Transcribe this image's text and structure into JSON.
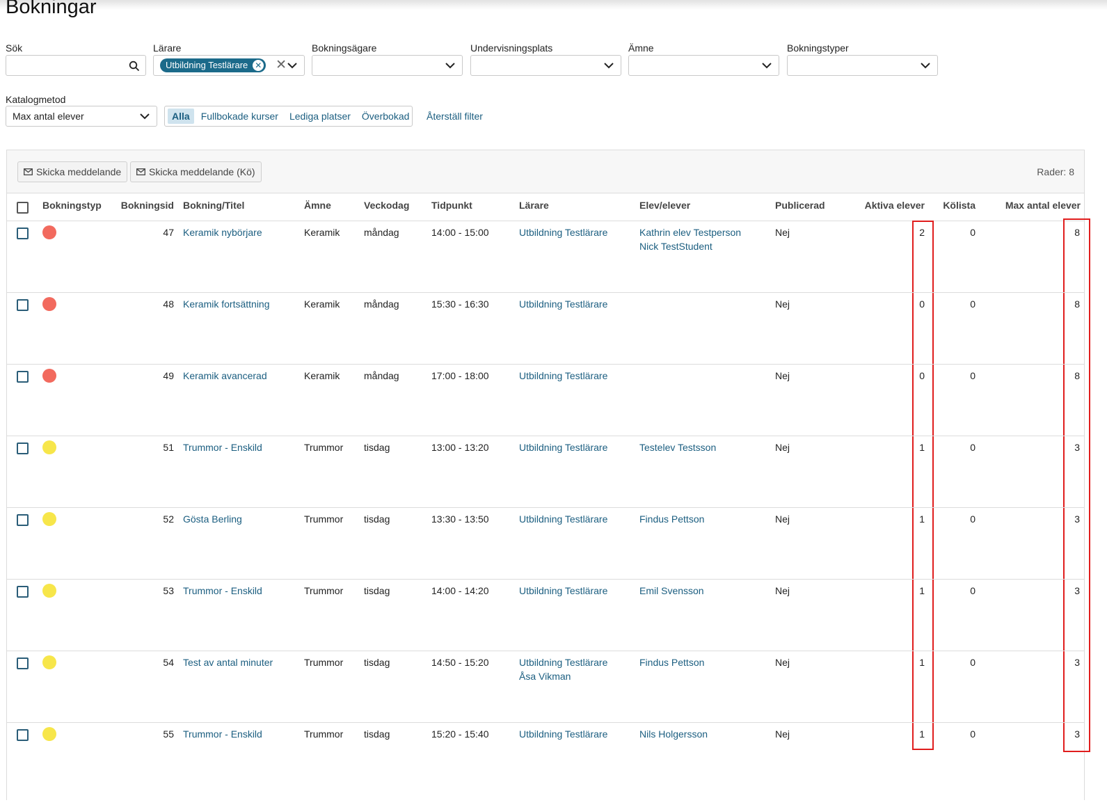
{
  "page": {
    "title": "Bokningar"
  },
  "filters": {
    "search": {
      "label": "Sök",
      "value": "",
      "icon": "search-icon"
    },
    "teacher": {
      "label": "Lärare",
      "chip": "Utbildning Testlärare",
      "chip_remove": "✕",
      "clear": "✕"
    },
    "booking_owner": {
      "label": "Bokningsägare",
      "value": ""
    },
    "location": {
      "label": "Undervisningsplats",
      "value": ""
    },
    "subject": {
      "label": "Ämne",
      "value": ""
    },
    "booking_types": {
      "label": "Bokningstyper",
      "value": ""
    },
    "catalog_method": {
      "label": "Katalogmetod",
      "value": "Max antal elever"
    },
    "segment": [
      "Alla",
      "Fullbokade kurser",
      "Lediga platser",
      "Överbokad"
    ],
    "segment_active": "Alla",
    "reset": "Återställ filter"
  },
  "toolbar": {
    "send_message": "Skicka meddelande",
    "send_message_queue": "Skicka meddelande (Kö)",
    "row_count": "Rader: 8"
  },
  "table": {
    "headers": {
      "type": "Bokningstyp",
      "id": "Bokningsid",
      "title": "Bokning/Titel",
      "subject": "Ämne",
      "weekday": "Veckodag",
      "time": "Tidpunkt",
      "teacher": "Lärare",
      "students": "Elev/elever",
      "published": "Publicerad",
      "active": "Aktiva elever",
      "queue": "Kölista",
      "max": "Max antal elever"
    },
    "colors": {
      "red": "#f26a5e",
      "yellow": "#f7e64a",
      "link": "#1b5e80",
      "highlight": "#e01d1d"
    },
    "rows": [
      {
        "color": "#f26a5e",
        "id": "47",
        "title": "Keramik nybörjare",
        "subject": "Keramik",
        "weekday": "måndag",
        "time": "14:00 - 15:00",
        "teacher1": "Utbildning Testlärare",
        "teacher2": "",
        "student1": "Kathrin elev Testperson",
        "student2": "Nick TestStudent",
        "published": "Nej",
        "active": "2",
        "queue": "0",
        "max": "8"
      },
      {
        "color": "#f26a5e",
        "id": "48",
        "title": "Keramik fortsättning",
        "subject": "Keramik",
        "weekday": "måndag",
        "time": "15:30 - 16:30",
        "teacher1": "Utbildning Testlärare",
        "teacher2": "",
        "student1": "",
        "student2": "",
        "published": "Nej",
        "active": "0",
        "queue": "0",
        "max": "8"
      },
      {
        "color": "#f26a5e",
        "id": "49",
        "title": "Keramik avancerad",
        "subject": "Keramik",
        "weekday": "måndag",
        "time": "17:00 - 18:00",
        "teacher1": "Utbildning Testlärare",
        "teacher2": "",
        "student1": "",
        "student2": "",
        "published": "Nej",
        "active": "0",
        "queue": "0",
        "max": "8"
      },
      {
        "color": "#f7e64a",
        "id": "51",
        "title": "Trummor - Enskild",
        "subject": "Trummor",
        "weekday": "tisdag",
        "time": "13:00 - 13:20",
        "teacher1": "Utbildning Testlärare",
        "teacher2": "",
        "student1": "Testelev Testsson",
        "student2": "",
        "published": "Nej",
        "active": "1",
        "queue": "0",
        "max": "3"
      },
      {
        "color": "#f7e64a",
        "id": "52",
        "title": "Gösta Berling",
        "subject": "Trummor",
        "weekday": "tisdag",
        "time": "13:30 - 13:50",
        "teacher1": "Utbildning Testlärare",
        "teacher2": "",
        "student1": "Findus Pettson",
        "student2": "",
        "published": "Nej",
        "active": "1",
        "queue": "0",
        "max": "3"
      },
      {
        "color": "#f7e64a",
        "id": "53",
        "title": "Trummor - Enskild",
        "subject": "Trummor",
        "weekday": "tisdag",
        "time": "14:00 - 14:20",
        "teacher1": "Utbildning Testlärare",
        "teacher2": "",
        "student1": "Emil Svensson",
        "student2": "",
        "published": "Nej",
        "active": "1",
        "queue": "0",
        "max": "3"
      },
      {
        "color": "#f7e64a",
        "id": "54",
        "title": "Test av antal minuter",
        "subject": "Trummor",
        "weekday": "tisdag",
        "time": "14:50 - 15:20",
        "teacher1": "Utbildning Testlärare",
        "teacher2": "Åsa Vikman",
        "student1": "Findus Pettson",
        "student2": "",
        "published": "Nej",
        "active": "1",
        "queue": "0",
        "max": "3"
      },
      {
        "color": "#f7e64a",
        "id": "55",
        "title": "Trummor - Enskild",
        "subject": "Trummor",
        "weekday": "tisdag",
        "time": "15:20 - 15:40",
        "teacher1": "Utbildning Testlärare",
        "teacher2": "",
        "student1": "Nils Holgersson",
        "student2": "",
        "published": "Nej",
        "active": "1",
        "queue": "0",
        "max": "3"
      }
    ]
  }
}
